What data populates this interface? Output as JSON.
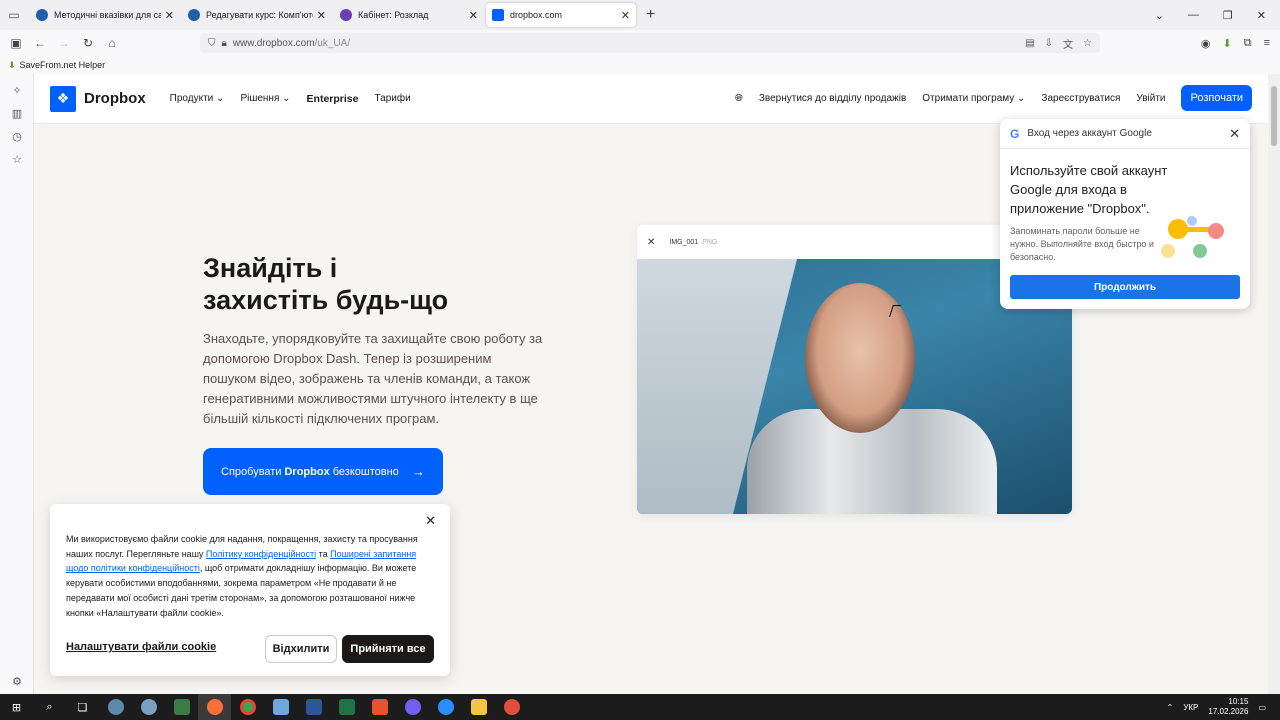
{
  "browser": {
    "tabs": [
      {
        "title": "Методичні вказівки для самос",
        "color": "#1f5fa8"
      },
      {
        "title": "Редагувати курс: Комп'ютерні",
        "color": "#1f5fa8"
      },
      {
        "title": "Кабінет: Розклад",
        "color": "#6a3fb0"
      },
      {
        "title": "dropbox.com",
        "color": "#0061fe"
      }
    ],
    "url_host": "www.dropbox.com",
    "url_path": "/uk_UA/",
    "bookmark": "SaveFrom.net Helper"
  },
  "header": {
    "logo": "Dropbox",
    "nav": [
      "Продукти",
      "Рішення",
      "Enterprise",
      "Тарифи"
    ],
    "sales": "Звернутися до відділу продажів",
    "get_app": "Отримати програму",
    "register": "Зареєструватися",
    "login": "Увійти",
    "cta": "Розпочати"
  },
  "hero": {
    "title_line1": "Знайдіть і",
    "title_line2": "захистіть будь-що",
    "paragraph": "Знаходьте, упорядковуйте та захищайте свою роботу за допомогою Dropbox Dash. Тепер із розширеним пошуком відео, зображень та членів команди, а також генеративними можливостями штучного інтелекту в ще більшій кількості підключених програм.",
    "try_prefix": "Спробувати",
    "try_brand": "Dropbox",
    "try_suffix": "безкоштовно"
  },
  "media": {
    "filename": "IMG_001",
    "filetype": "PNG"
  },
  "cookie": {
    "text_1": "Ми використовуємо файли cookie для надання, покращення, захисту та просування наших послуг. Перегляньте нашу ",
    "link_1": "Політику конфіденційності",
    "text_2": " та ",
    "link_2": "Поширені запитання щодо політики конфіденційності",
    "text_3": ", щоб отримати докладнішу інформацію. Ви можете керувати особистими вподобаннями, зокрема параметром «Не продавати й не передавати мої особисті дані третім сторонам», за допомогою розташованої нижче кнопки «Налаштувати файли cookie».",
    "settings": "Налаштувати файли cookie",
    "decline": "Відхилити",
    "accept": "Прийняти все"
  },
  "google_popup": {
    "header": "Вход через аккаунт Google",
    "title": "Используйте свой аккаунт Google для входа в приложение \"Dropbox\".",
    "subtitle": "Запоминать пароли больше не нужно. Выполняйте вход быстро и безопасно.",
    "button": "Продолжить"
  },
  "taskbar": {
    "lang": "УКР",
    "time": "10:15",
    "date": "17.02.2026"
  }
}
